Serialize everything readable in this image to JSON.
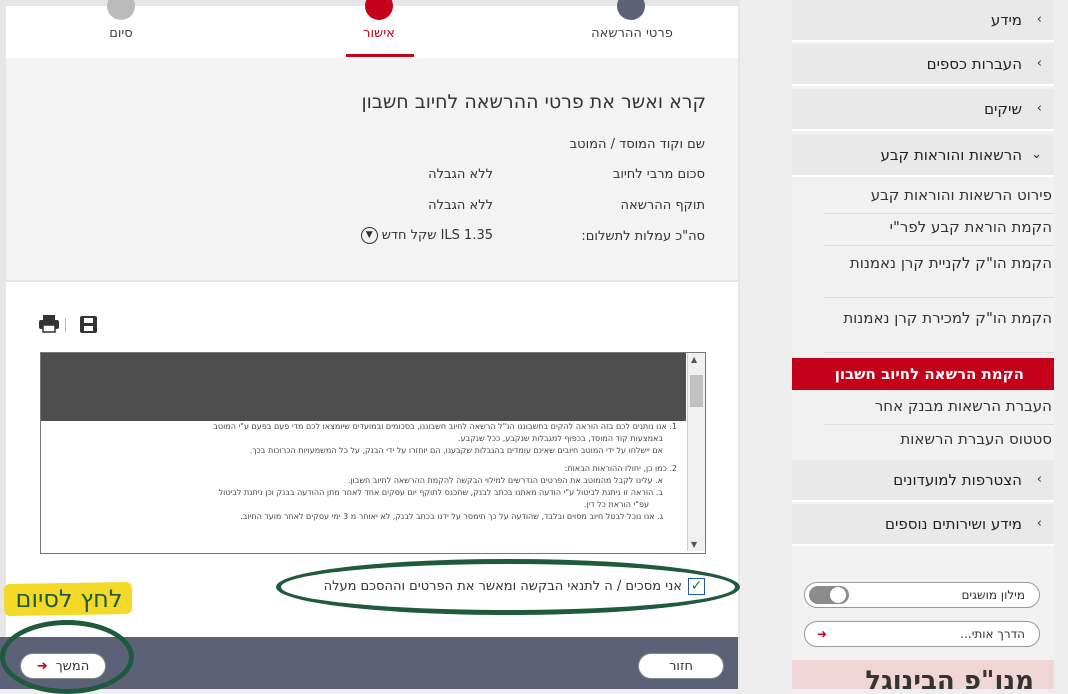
{
  "stepper": {
    "steps": [
      "פרטי ההרשאה",
      "אישור",
      "סיום"
    ]
  },
  "summary": {
    "title": "קרא ואשר את פרטי ההרשאה לחיוב חשבון",
    "rows": [
      {
        "label": "שם וקוד המוסד / המוטב",
        "value": ""
      },
      {
        "label": "סכום מרבי לחיוב",
        "value": "ללא הגבלה"
      },
      {
        "label": "תוקף ההרשאה",
        "value": "ללא הגבלה"
      },
      {
        "label": "סה\"כ עמלות לתשלום:",
        "value": "ILS 1.35 שקל חדש"
      }
    ]
  },
  "toolbar": {
    "print_icon": "printer-icon",
    "save_icon": "save-icon"
  },
  "document": {
    "lines": [
      "1.   אנו נותנים לכם בזה הוראה להקים בחשבוננו הנ\"ל הרשאה לחיוב חשבוננו, בסכומים ובמועדים שיומצאו לכם מדי פעם בפעם ע\"י המוטב",
      "באמצעות קוד המוסד, בכפוף למגבלות שנקבע, ככל שנקבע.",
      "אם יישלחו על ידי המוטב חיובים שאינם עומדים בהגבלות שקבענו, הם יוחזרו על ידי הבנק, על כל המשמעויות הכרוכות בכך.",
      "2.   כמו כן, יחולו ההוראות הבאות:",
      "א.  עלינו לקבל מהמוטב את הפרטים הנדרשים למילוי הבקשה להקמת ההרשאה לחיוב חשבון.",
      "ב.  הוראה זו ניתנת לביטול ע\"י הודעה מאתנו בכתב לבנק, שתכנס לתוקף יום עסקים אחד לאחר מתן ההודעה בבנק וכן ניתנת לביטול",
      "עפ\"י הוראת כל דין.",
      "ג.  אנו נוכל לבטל חיוב מסוים ובלבד, שהודעה על כך תימסר על ידנו בכתב לבנק, לא יאוחר מ 3 ימי עסקים לאחר מועד החיוב."
    ]
  },
  "consent": {
    "label": "אני מסכים / ה לתנאי הבקשה ומאשר את הפרטים וההסכם מעלה",
    "checked": true
  },
  "footer": {
    "continue_label": "המשך",
    "back_label": "חזור"
  },
  "annotation": {
    "text": "לחץ לסיום"
  },
  "sidebar": {
    "menu": [
      "מידע",
      "העברות כספים",
      "שיקים",
      "הרשאות והוראות קבע"
    ],
    "submenu": [
      "פירוט הרשאות והוראות קבע",
      "הקמת הוראת קבע לפר\"י",
      "הקמת הו\"ק לקניית קרן נאמנות",
      "הקמת הו\"ק למכירת קרן נאמנות",
      "הקמת הרשאה לחיוב חשבון",
      "העברת הרשאות מבנק אחר",
      "סטטוס העברת הרשאות"
    ],
    "menu2": [
      "הצטרפות למועדונים",
      "מידע ושירותים נוספים"
    ],
    "glossary": "מילון מושגים",
    "guide": "הדרך אותי...",
    "banner": "מנו\"פ הבינוגל"
  },
  "colors": {
    "accent": "#c4001a",
    "footer": "#5b6278",
    "annotation": "#1f5a3d",
    "highlight": "#f4d928"
  }
}
